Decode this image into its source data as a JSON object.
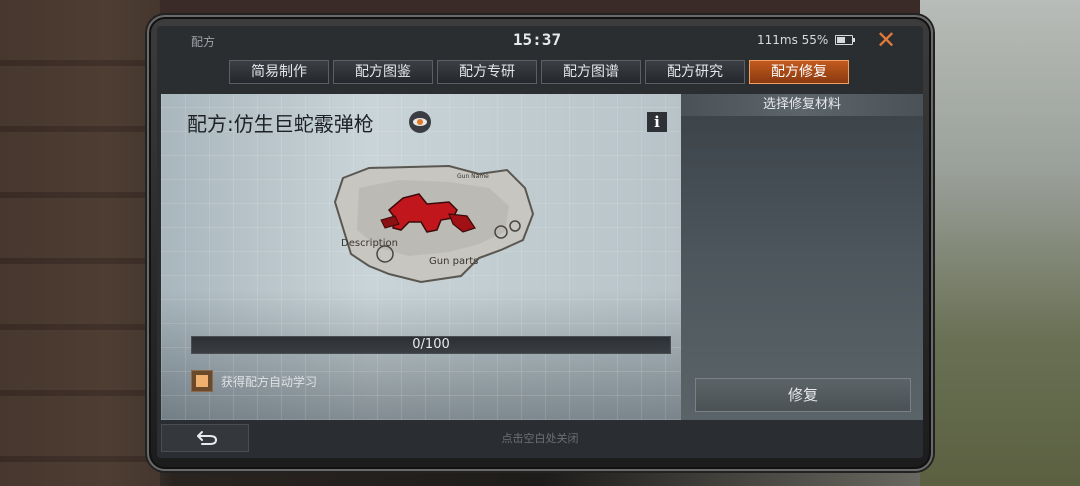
{
  "status_bar": {
    "app_title": "配方",
    "time": "15:37",
    "ping_battery": "111ms 55%",
    "battery_icon": "battery-icon",
    "close_icon": "close-icon"
  },
  "tabs": [
    {
      "label": "简易制作",
      "active": false
    },
    {
      "label": "配方图鉴",
      "active": false
    },
    {
      "label": "配方专研",
      "active": false
    },
    {
      "label": "配方图谱",
      "active": false
    },
    {
      "label": "配方研究",
      "active": false
    },
    {
      "label": "配方修复",
      "active": true
    }
  ],
  "recipe": {
    "title": "配方:仿生巨蛇霰弹枪",
    "blueprint_texts": {
      "description": "Description",
      "gun_parts": "Gun parts",
      "gun_name": "Gun Name"
    },
    "progress_text": "0/100",
    "progress_value": 0,
    "progress_max": 100,
    "auto_learn_label": "获得配方自动学习",
    "auto_learn_checked": true
  },
  "repair_panel": {
    "header": "选择修复材料",
    "repair_button_label": "修复"
  },
  "bottom": {
    "tap_hint": "点击空白处关闭"
  },
  "colors": {
    "accent": "#c25a1e",
    "weapon_red": "#c0161c"
  }
}
